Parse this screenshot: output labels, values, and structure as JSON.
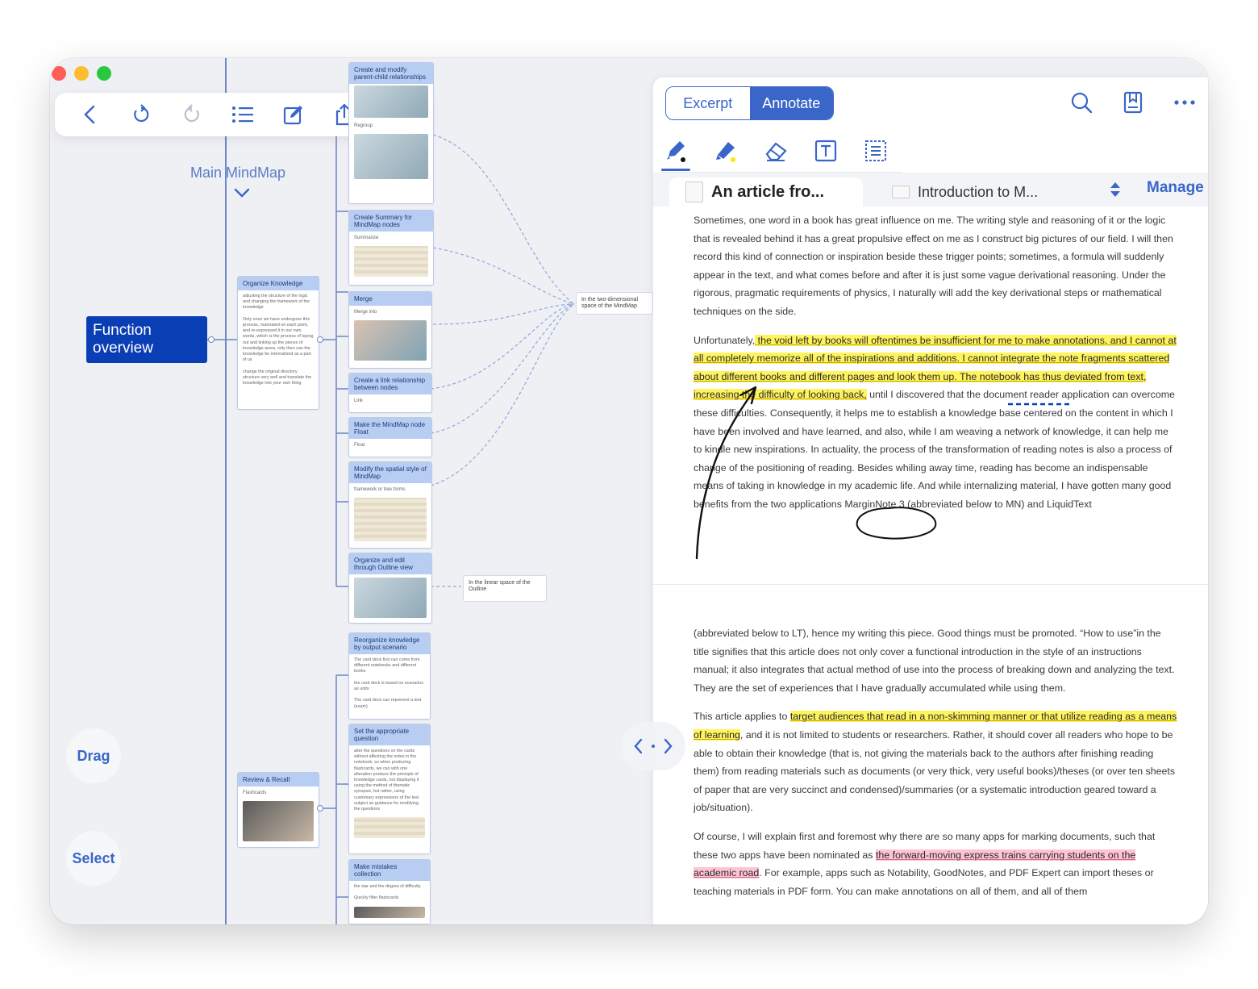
{
  "toolbar": {
    "icons": [
      "back-icon",
      "undo-icon",
      "redo-icon",
      "list-icon",
      "edit-icon",
      "share-icon",
      "more-icon"
    ]
  },
  "mindmap": {
    "title": "Main MindMap",
    "root": "Function overview",
    "branch_organize": {
      "title": "Organize Knowledge",
      "body": "adjusting the structure of the logic and changing the framework of the knowledge\n\nOnly once we have undergone this process, marinated on each point, and re-expressed it in our own words, which is the process of laying out and linking up the pieces of knowledge anew, only then can the knowledge be internalised as a part of us\n\nchange the original directory structure very well and translate the knowledge into your own thing"
    },
    "branch_review": {
      "title": "Review & Recall",
      "body": "Flashcards"
    },
    "cards": [
      {
        "title": "Create and modify parent-child relationships",
        "sub": "Regroup"
      },
      {
        "title": "Create Summary for MindMap nodes",
        "sub": "Summarize"
      },
      {
        "title": "Merge",
        "sub": "Merge into"
      },
      {
        "title": "Create a link relationship between nodes",
        "sub": "Link"
      },
      {
        "title": "Make the MindMap node Float",
        "sub": "Float"
      },
      {
        "title": "Modify the spatial style of MindMap",
        "sub": "framework or tree forms"
      },
      {
        "title": "Organize and edit through Outline view",
        "sub": ""
      },
      {
        "title": "Reorganize knowledge by output scenario",
        "sub": "The card deck first can come from different notebooks and different books\n\nthe card deck is based on scenarios as units\n\nThe card deck can represent a test (exam)"
      },
      {
        "title": "Set the appropriate question",
        "sub": "alter the questions on the cards without affecting the notes in the notebook, so when producing flashcards, we can with one alteration produce the principle of knowledge cards, not displaying it using the method of thematic synopsis, but rather, using customary expressions of the test subject as guidance for modifying the questions"
      },
      {
        "title": "Make mistakes collection",
        "sub": "the star and the degree of difficulty\n\nQuickly filter flashcards"
      }
    ],
    "label_2d": "In the two-dimensional space of the MindMap",
    "label_linear": "In the linear space of the Outline",
    "drag_label": "Drag",
    "select_label": "Select"
  },
  "reader": {
    "mode_excerpt": "Excerpt",
    "mode_annotate": "Annotate",
    "tab_active": "An article fro...",
    "tab_inactive": "Introduction to M...",
    "manage": "Manage",
    "tools": [
      "pen-icon",
      "highlighter-icon",
      "eraser-icon",
      "textbox-icon",
      "lasso-select-icon"
    ],
    "p1": "Sometimes, one word in a book has great influence on me. The writing style and reasoning of it or the logic that is revealed behind it has a great propulsive effect on me as I construct big pictures of our field. I will then record this kind of connection or inspiration beside these trigger points; sometimes, a formula will suddenly appear in the text, and what comes before and after it is just some vague derivational reasoning. Under the rigorous, pragmatic requirements of physics, I naturally will add the key derivational steps or mathematical techniques on the side.",
    "p2a": "Unfortunately,",
    "p2_hl": " the void left by books will oftentimes be insufficient for me to make annotations, and I cannot at all completely memorize all of the inspirations and additions. I cannot integrate the note fragments scattered about different books and different pages and look them up. The notebook has thus deviated from text, increasing the difficulty of looking back,",
    "p2b": " until I discovered that the document reader application can overcome these difficulties. Consequently, it helps me to establish a knowledge base centered on the content in which I have been involved and have learned, and also, while I am weaving a network of knowledge, it can help me to kindle new inspirations. In actuality, the process of the transformation of reading notes is also a process of change of the positioning of reading. Besides whiling away time, reading has become an indispensable means of taking in knowledge in my academic life. And while internalizing material, I have gotten many good benefits from the two applications MarginNote 3 (abbreviated below to MN) and LiquidText",
    "p3": "(abbreviated below to LT), hence my writing this piece. Good things must be promoted. “How to use”in the title signifies that this article does not only cover a functional introduction in the style of an instructions manual; it also integrates that actual method of use into the process of breaking down and analyzing the text. They are the set of experiences that I have gradually accumulated while using them.",
    "p4a": "This article applies to ",
    "p4_hl": "target audiences that read in a non-skimming manner or that utilize reading as a means of learning",
    "p4b": ", and it is not limited to students or researchers. Rather, it should cover all readers who hope to be able to obtain their knowledge (that is, not giving the materials back to the authors after finishing reading them) from reading materials such as documents (or very thick, very useful books)/theses (or over ten sheets of paper that are very succinct and condensed)/summaries (or a systematic introduction geared toward a job/situation).",
    "p5a": "Of course, I will explain first and foremost why there are so many apps for marking documents, such that these two apps have been nominated as ",
    "p5_hl": "the forward-moving express trains carrying students on the academic road",
    "p5b": ". For example, apps such as Notability, GoodNotes, and PDF Expert can import theses or teaching materials in PDF form. You can make annotations on all of them, and all of them"
  },
  "colors": {
    "accent": "#3a66c9",
    "root_node": "#0a3eb5",
    "highlight_yellow": "#fff45e",
    "highlight_pink": "#ffc4d3"
  }
}
